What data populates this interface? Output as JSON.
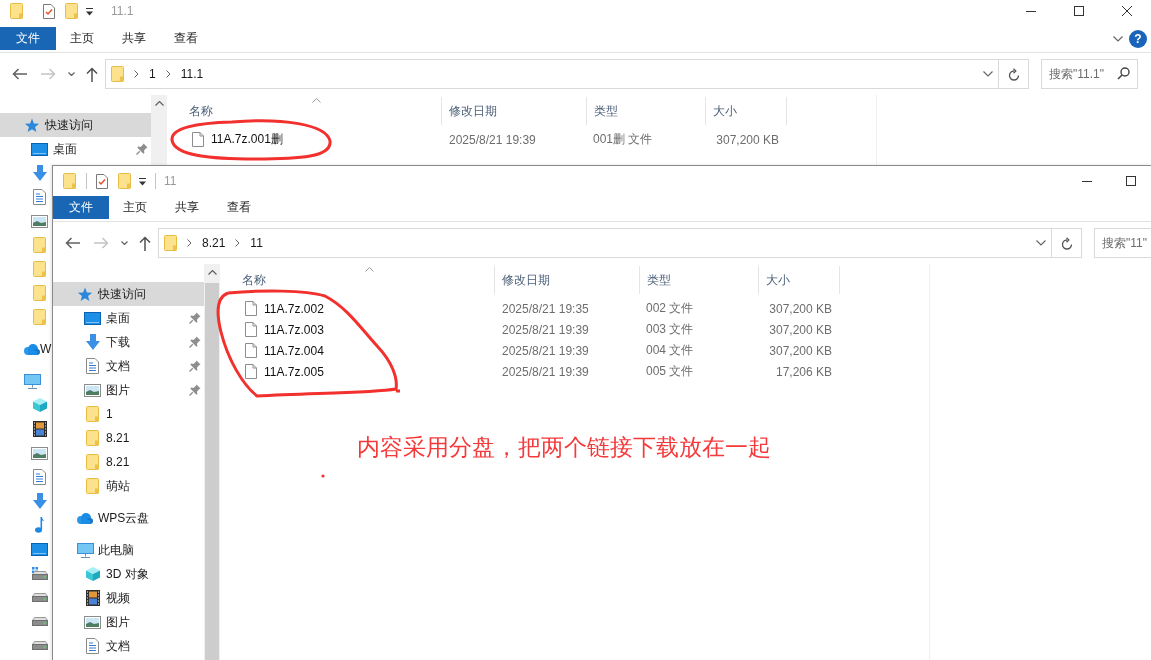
{
  "windows": [
    {
      "title": "11.1",
      "ribbon_tabs": [
        {
          "label": "文件",
          "kind": "file"
        },
        {
          "label": "主页",
          "kind": "tab"
        },
        {
          "label": "共享",
          "kind": "tab"
        },
        {
          "label": "查看",
          "kind": "tab"
        }
      ],
      "help_button": "?",
      "address": [
        "1",
        "11.1"
      ],
      "search": {
        "placeholder": "搜索\"11.1\""
      },
      "sidebar": [
        {
          "label": "快速访问",
          "kind": "quickaccess",
          "selected": true,
          "pinned": false,
          "children": [
            {
              "label": "桌面",
              "kind": "desktop",
              "selected": false,
              "pinned": true
            },
            {
              "kind": "download",
              "selected": false,
              "pinned": false
            },
            {
              "kind": "documents",
              "selected": false,
              "pinned": false
            },
            {
              "kind": "pictures",
              "selected": false,
              "pinned": false
            },
            {
              "kind": "folder",
              "selected": false,
              "pinned": false
            },
            {
              "kind": "folder",
              "selected": false,
              "pinned": false
            },
            {
              "kind": "folder",
              "selected": false,
              "pinned": false
            },
            {
              "kind": "folder",
              "selected": false,
              "pinned": false
            }
          ]
        },
        {
          "label": "W",
          "kind": "cloud",
          "selected": false,
          "pinned": false
        },
        {
          "kind": "computer",
          "selected": false,
          "pinned": false,
          "children": [
            {
              "kind": "objects",
              "selected": false,
              "pinned": false
            },
            {
              "kind": "video",
              "selected": false,
              "pinned": false
            },
            {
              "kind": "pictures",
              "selected": false,
              "pinned": false
            },
            {
              "kind": "documents",
              "selected": false,
              "pinned": false
            },
            {
              "kind": "download",
              "selected": false,
              "pinned": false
            },
            {
              "kind": "music",
              "selected": false,
              "pinned": false
            },
            {
              "kind": "desktop",
              "selected": false,
              "pinned": false
            },
            {
              "kind": "systemdrive",
              "selected": false,
              "pinned": false
            },
            {
              "kind": "drive",
              "selected": false,
              "pinned": false
            },
            {
              "kind": "drive",
              "selected": false,
              "pinned": false
            },
            {
              "kind": "drive",
              "selected": false,
              "pinned": false
            }
          ]
        }
      ],
      "columns": [
        {
          "label": "名称",
          "sorted": true
        },
        {
          "label": "修改日期",
          "sorted": false
        },
        {
          "label": "类型",
          "sorted": false
        },
        {
          "label": "大小",
          "sorted": false
        }
      ],
      "rows": [
        {
          "name": "11A.7z.001删",
          "modified": "2025/8/21 19:39",
          "type": "001删 文件",
          "size": "307,200 KB"
        }
      ]
    },
    {
      "title": "11",
      "ribbon_tabs": [
        {
          "label": "文件",
          "kind": "file"
        },
        {
          "label": "主页",
          "kind": "tab"
        },
        {
          "label": "共享",
          "kind": "tab"
        },
        {
          "label": "查看",
          "kind": "tab"
        }
      ],
      "address": [
        "8.21",
        "11"
      ],
      "search": {
        "placeholder": "搜索\"11\""
      },
      "sidebar": [
        {
          "label": "快速访问",
          "kind": "quickaccess",
          "selected": true,
          "pinned": false,
          "children": [
            {
              "label": "桌面",
              "kind": "desktop",
              "selected": false,
              "pinned": true
            },
            {
              "label": "下载",
              "kind": "download",
              "selected": false,
              "pinned": true
            },
            {
              "label": "文档",
              "kind": "documents",
              "selected": false,
              "pinned": true
            },
            {
              "label": "图片",
              "kind": "pictures",
              "selected": false,
              "pinned": true
            },
            {
              "label": "1",
              "kind": "folder",
              "selected": false,
              "pinned": false
            },
            {
              "label": "8.21",
              "kind": "folder",
              "selected": false,
              "pinned": false
            },
            {
              "label": "8.21",
              "kind": "folder",
              "selected": false,
              "pinned": false
            },
            {
              "label": "萌站",
              "kind": "folder",
              "selected": false,
              "pinned": false
            }
          ]
        },
        {
          "label": "WPS云盘",
          "kind": "cloud",
          "selected": false,
          "pinned": false
        },
        {
          "label": "此电脑",
          "kind": "computer",
          "selected": false,
          "pinned": false,
          "children": [
            {
              "label": "3D 对象",
              "kind": "objects",
              "selected": false,
              "pinned": false
            },
            {
              "label": "视频",
              "kind": "video",
              "selected": false,
              "pinned": false
            },
            {
              "label": "图片",
              "kind": "pictures",
              "selected": false,
              "pinned": false
            },
            {
              "label": "文档",
              "kind": "documents",
              "selected": false,
              "pinned": false
            }
          ]
        }
      ],
      "columns": [
        {
          "label": "名称",
          "sorted": true
        },
        {
          "label": "修改日期",
          "sorted": false
        },
        {
          "label": "类型",
          "sorted": false
        },
        {
          "label": "大小",
          "sorted": false
        }
      ],
      "rows": [
        {
          "name": "11A.7z.002",
          "modified": "2025/8/21 19:35",
          "type": "002 文件",
          "size": "307,200 KB"
        },
        {
          "name": "11A.7z.003",
          "modified": "2025/8/21 19:39",
          "type": "003 文件",
          "size": "307,200 KB"
        },
        {
          "name": "11A.7z.004",
          "modified": "2025/8/21 19:39",
          "type": "004 文件",
          "size": "307,200 KB"
        },
        {
          "name": "11A.7z.005",
          "modified": "2025/8/21 19:39",
          "type": "005 文件",
          "size": "17,206 KB"
        }
      ]
    }
  ],
  "annotation": {
    "note": "内容采用分盘，把两个链接下载放在一起"
  }
}
